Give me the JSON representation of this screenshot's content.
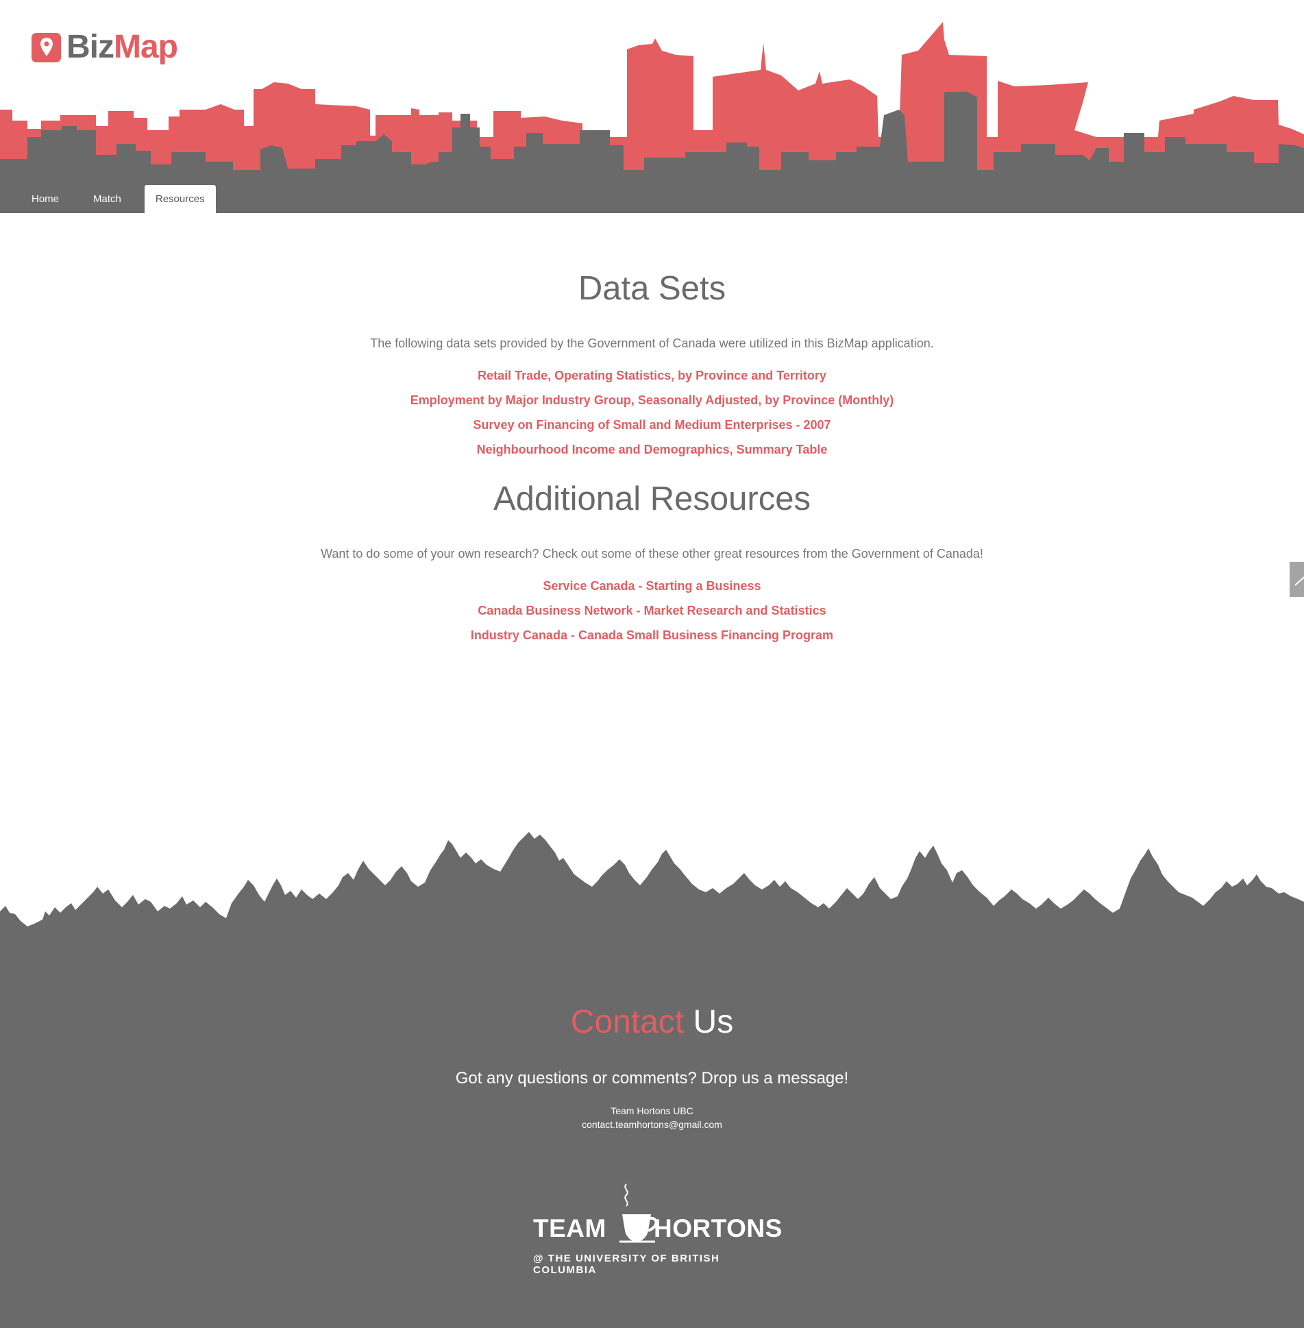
{
  "brand": {
    "biz": "Biz",
    "map": "Map",
    "accent_color": "#e35d61",
    "dark_color": "#6a6a6a"
  },
  "nav": {
    "tabs": [
      {
        "label": "Home",
        "active": false
      },
      {
        "label": "Match",
        "active": false
      },
      {
        "label": "Resources",
        "active": true
      }
    ]
  },
  "data_sets": {
    "title": "Data Sets",
    "description": "The following data sets provided by the Government of Canada were utilized in this BizMap application.",
    "links": [
      "Retail Trade, Operating Statistics, by Province and Territory",
      "Employment by Major Industry Group, Seasonally Adjusted, by Province (Monthly)",
      "Survey on Financing of Small and Medium Enterprises - 2007",
      "Neighbourhood Income and Demographics, Summary Table"
    ]
  },
  "additional_resources": {
    "title": "Additional Resources",
    "description": "Want to do some of your own research? Check out some of these other great resources from the Government of Canada!",
    "links": [
      "Service Canada - Starting a Business",
      "Canada Business Network - Market Research and Statistics",
      "Industry Canada - Canada Small Business Financing Program"
    ]
  },
  "contact": {
    "title_accent": "Contact",
    "title_rest": "Us",
    "subtitle": "Got any questions or comments? Drop us a message!",
    "team": "Team Hortons UBC",
    "email": "contact.teamhortons@gmail.com"
  },
  "team_logo": {
    "left": "TEAM",
    "right": "HORTONS",
    "university": "@ THE UNIVERSITY OF BRITISH COLUMBIA"
  },
  "icons": {
    "logo": "map-pin-icon",
    "scroll_top": "chevron-up-icon",
    "team_logo": "coffee-cup-icon"
  }
}
